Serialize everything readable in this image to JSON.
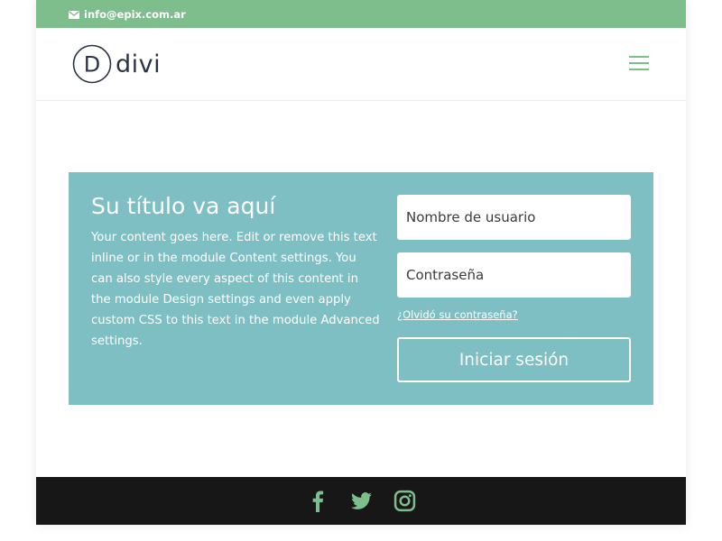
{
  "colors": {
    "accent_green": "#7ebd8c",
    "login_panel_bg": "#7ebfc4",
    "footer_bg": "#171717",
    "logo_text": "#2c3444"
  },
  "topbar": {
    "email": "info@epix.com.ar",
    "email_icon": "envelope-icon"
  },
  "header": {
    "logo_text": "divi",
    "logo_mark_letter": "D",
    "menu_icon": "hamburger-menu-icon"
  },
  "login": {
    "title": "Su título va aquí",
    "description": "Your content goes here. Edit or remove this text inline or in the module Content settings. You can also style every aspect of this content in the module Design settings and even apply custom CSS to this text in the module Advanced settings.",
    "username_placeholder": "Nombre de usuario",
    "password_placeholder": "Contraseña",
    "forgot_password": "¿Olvidó su contraseña?",
    "submit_label": "Iniciar sesión"
  },
  "footer": {
    "social_icons": [
      "facebook-icon",
      "twitter-icon",
      "instagram-icon"
    ]
  }
}
